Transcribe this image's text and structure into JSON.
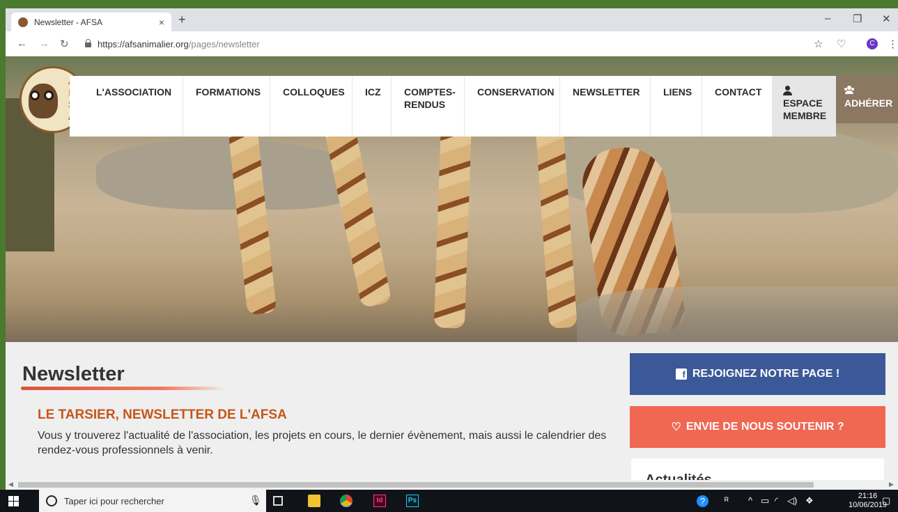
{
  "browser": {
    "tab_title": "Newsletter - AFSA",
    "tab_close": "×",
    "new_tab": "+",
    "url_domain": "https://afsanimalier.org",
    "url_path": "/pages/newsletter",
    "profile_initial": "C"
  },
  "logo": {
    "letters": [
      "A",
      "F",
      "S",
      "A"
    ]
  },
  "nav": {
    "items": [
      {
        "label": "L'ASSOCIATION"
      },
      {
        "label": "FORMATIONS"
      },
      {
        "label": "COLLOQUES"
      },
      {
        "label": "ICZ"
      },
      {
        "label": "COMPTES-RENDUS",
        "line1": "COMPTES-",
        "line2": "RENDUS"
      },
      {
        "label": "CONSERVATION"
      },
      {
        "label": "NEWSLETTER"
      },
      {
        "label": "LIENS"
      },
      {
        "label": "CONTACT"
      }
    ],
    "espace_line1": "ESPACE",
    "espace_line2": "MEMBRE",
    "adherer": "ADHÉRER"
  },
  "content": {
    "page_title": "Newsletter",
    "subtitle": "LE TARSIER, NEWSLETTER DE L'AFSA",
    "intro": "Vous y trouverez l'actualité de l'association, les projets en cours, le dernier évènement, mais aussi le calendrier des rendez-vous professionnels à venir."
  },
  "sidebar": {
    "facebook_label": "REJOIGNEZ NOTRE PAGE !",
    "support_label": "ENVIE DE NOUS SOUTENIR ?",
    "news_title": "Actualités"
  },
  "taskbar": {
    "search_placeholder": "Taper ici pour rechercher",
    "time": "21:16",
    "date": "10/06/2019"
  },
  "colors": {
    "nav_adherer_bg": "#8c7762",
    "facebook_blue": "#3b5998",
    "support_coral": "#f06752",
    "subtitle_orange": "#c5561a"
  }
}
